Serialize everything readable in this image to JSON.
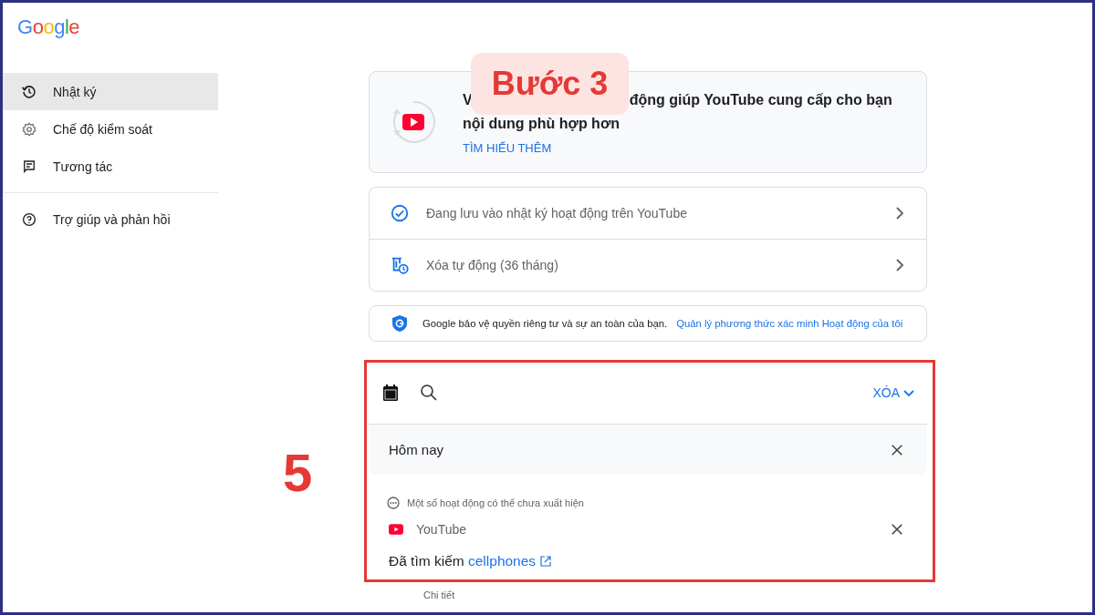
{
  "logo": "Google",
  "sidebar": {
    "items": [
      {
        "label": "Nhật ký",
        "selected": true
      },
      {
        "label": "Chế độ kiểm soát",
        "selected": false
      },
      {
        "label": "Tương tác",
        "selected": false
      }
    ],
    "footer_items": [
      {
        "label": "Trợ giúp và phản hồi"
      }
    ]
  },
  "info_card": {
    "title_parts": [
      "V",
      "động giúp YouTube cung cấp cho bạn"
    ],
    "title_line_2": "nội dung phù hợp hơn",
    "link": "TÌM HIỂU THÊM"
  },
  "settings": [
    {
      "label": "Đang lưu vào nhật ký hoạt động trên YouTube"
    },
    {
      "label": "Xóa tự động (36 tháng)"
    }
  ],
  "privacy": {
    "text": "Google bảo vệ quyền riêng tư và sự an toàn của bạn.",
    "link": "Quản lý phương thức xác minh Hoạt động của tôi"
  },
  "toolbar": {
    "delete_button": "XÓA"
  },
  "day_header": "Hôm nay",
  "notice": "Một số hoạt động có thể chưa xuất hiện",
  "activity": {
    "source": "YouTube",
    "action": "Đã tìm kiếm",
    "query": "cellphones",
    "details": "Chi tiết"
  },
  "annotations": {
    "step_badge": "Bước 3",
    "number": "5"
  }
}
